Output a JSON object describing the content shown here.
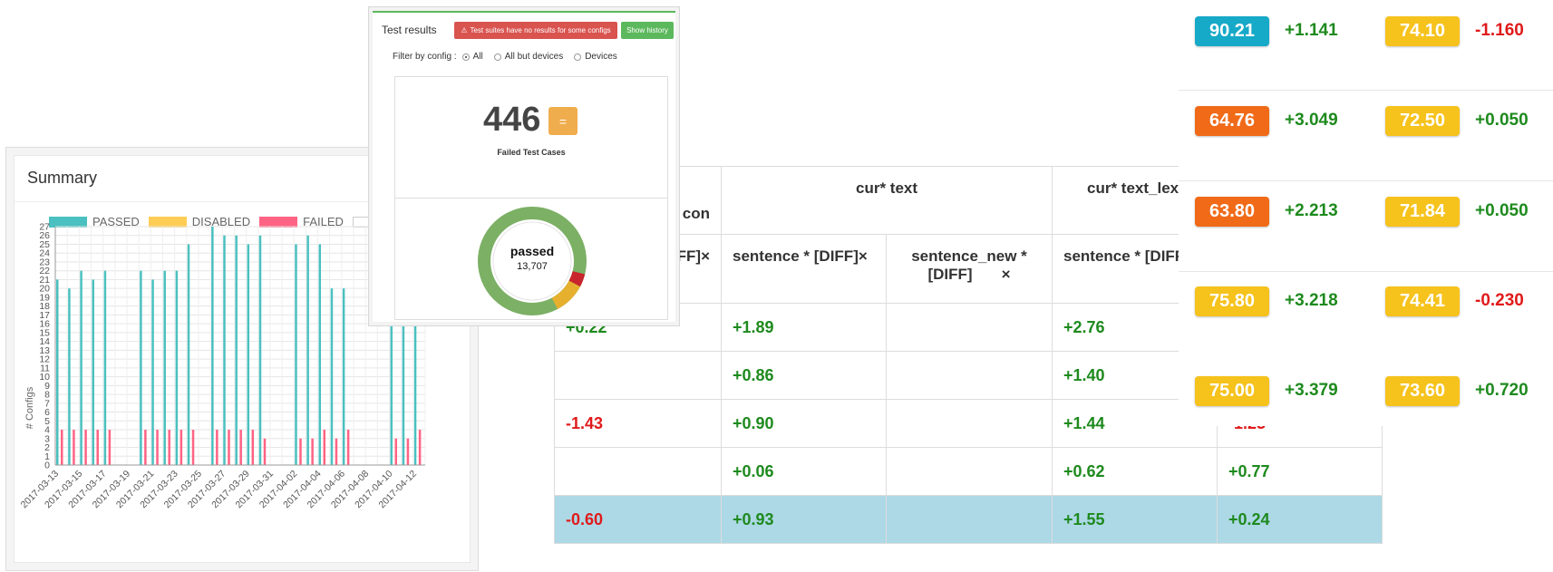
{
  "summary": {
    "title": "Summary",
    "legend": [
      {
        "label": "PASSED",
        "color": "#4bc0c0"
      },
      {
        "label": "DISABLED",
        "color": "#ffcd56"
      },
      {
        "label": "FAILED",
        "color": "#ff6384"
      }
    ]
  },
  "chart_data": {
    "type": "bar",
    "ylabel": "# Configs",
    "ylim": [
      0,
      27
    ],
    "dates": [
      "2017-03-13",
      "2017-03-14",
      "2017-03-15",
      "2017-03-16",
      "2017-03-17",
      "2017-03-18",
      "2017-03-19",
      "2017-03-20",
      "2017-03-21",
      "2017-03-22",
      "2017-03-23",
      "2017-03-24",
      "2017-03-25",
      "2017-03-26",
      "2017-03-27",
      "2017-03-28",
      "2017-03-29",
      "2017-03-30",
      "2017-03-31",
      "2017-04-01",
      "2017-04-02",
      "2017-04-03",
      "2017-04-04",
      "2017-04-05",
      "2017-04-06",
      "2017-04-07",
      "2017-04-08",
      "2017-04-09",
      "2017-04-10",
      "2017-04-11",
      "2017-04-12"
    ],
    "xtick_labels": [
      "2017-03-13",
      "2017-03-15",
      "2017-03-17",
      "2017-03-19",
      "2017-03-21",
      "2017-03-23",
      "2017-03-25",
      "2017-03-27",
      "2017-03-29",
      "2017-03-31",
      "2017-04-02",
      "2017-04-04",
      "2017-04-06",
      "2017-04-08",
      "2017-04-10",
      "2017-04-12"
    ],
    "series": [
      {
        "name": "PASSED",
        "color": "#4bc0c0",
        "values": [
          21,
          20,
          22,
          21,
          22,
          0,
          0,
          22,
          21,
          22,
          22,
          25,
          0,
          27,
          26,
          26,
          25,
          26,
          0,
          0,
          25,
          26,
          25,
          20,
          20,
          0,
          0,
          0,
          20,
          20,
          20
        ]
      },
      {
        "name": "FAILED",
        "color": "#ff6384",
        "values": [
          4,
          4,
          4,
          4,
          4,
          0,
          0,
          4,
          4,
          4,
          4,
          4,
          0,
          4,
          4,
          4,
          4,
          3,
          0,
          0,
          3,
          3,
          4,
          3,
          4,
          0,
          0,
          0,
          3,
          3,
          4
        ]
      }
    ]
  },
  "table": {
    "headers": {
      "col1_partial": "con",
      "cur_text": "cur* text",
      "cur_text_lex": "cur* text_lex"
    },
    "subheaders": {
      "col1_partial": "FF]×",
      "s1": "sentence * [DIFF]×",
      "s2_line1": "sentence_new *",
      "s2_line2": "[DIFF]",
      "s2_close": "×",
      "s3": "sentence * [DIFF]"
    },
    "rows": [
      {
        "c1": "+0.22",
        "c2": "+1.89",
        "c3": "",
        "c4": "+2.76",
        "c5": "",
        "hl": false
      },
      {
        "c1": "",
        "c2": "+0.86",
        "c3": "",
        "c4": "+1.40",
        "c5": "",
        "hl": false
      },
      {
        "c1": "-1.43",
        "c2": "+0.90",
        "c3": "",
        "c4": "+1.44",
        "c5": "-1.23",
        "hl": false
      },
      {
        "c1": "",
        "c2": "+0.06",
        "c3": "",
        "c4": "+0.62",
        "c5": "+0.77",
        "hl": false
      },
      {
        "c1": "-0.60",
        "c2": "+0.93",
        "c3": "",
        "c4": "+1.55",
        "c5": "+0.24",
        "hl": true
      }
    ]
  },
  "test_results": {
    "title": "Test results",
    "warning": "Test suites have no results for some configs",
    "history_button": "Show history",
    "filter_label": "Filter by config :",
    "filter_options": [
      "All",
      "All but devices",
      "Devices"
    ],
    "failed_count": "446",
    "failed_badge": "=",
    "failed_label": "Failed Test Cases",
    "donut_label": "passed",
    "donut_count": "13,707",
    "donut_colors": {
      "passed": "#7cb065",
      "other": "#e6b02e",
      "failed": "#c9252c"
    }
  },
  "scores": [
    {
      "a": "90.21",
      "a_color": "#16a9c8",
      "da": "+1.141",
      "b": "74.10",
      "b_color": "#f6c21c",
      "db": "-1.160"
    },
    {
      "a": "64.76",
      "a_color": "#f06a18",
      "da": "+3.049",
      "b": "72.50",
      "b_color": "#f6c21c",
      "db": "+0.050"
    },
    {
      "a": "63.80",
      "a_color": "#f06a18",
      "da": "+2.213",
      "b": "71.84",
      "b_color": "#f6c21c",
      "db": "+0.050"
    },
    {
      "a": "75.80",
      "a_color": "#f6c21c",
      "da": "+3.218",
      "b": "74.41",
      "b_color": "#f6c21c",
      "db": "-0.230"
    },
    {
      "a": "75.00",
      "a_color": "#f6c21c",
      "da": "+3.379",
      "b": "73.60",
      "b_color": "#f6c21c",
      "db": "+0.720"
    }
  ]
}
